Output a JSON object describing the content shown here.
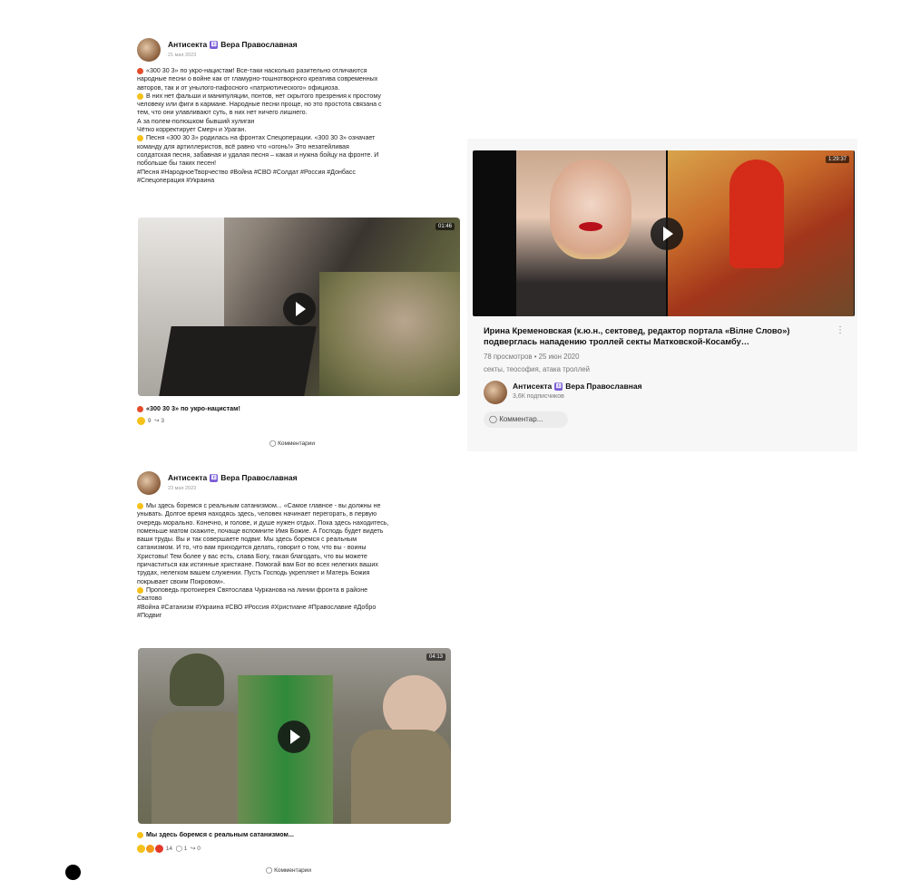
{
  "post1": {
    "author": "Антисекта",
    "author2": "Вера Православная",
    "badge": "⚅",
    "date": "21 мая 2023",
    "text": [
      "«300 30 3» по укро-нацистам! Все-таки насколько разительно отличаются",
      "народные песни о войне как от гламурно-тошнотворного креатива современных",
      "авторов, так и от унылого-пафосного «патриотического» официоза.",
      "В них нет фальши и манипуляции, понтов, нет скрытого презрения к простому",
      "человеку или фиги в кармане. Народные песни проще, но это простота связана с",
      "тем, что они улавливают суть, в них нет ничего лишнего.",
      "А за полем-полюшком бывший хулиган",
      "Чётко корректирует Смерч и Ураган.",
      "Песня «300 30 3» родилась на фронтах Спецоперации. «300 30 3» означает",
      "команду для артиллеристов, всё равно что «огонь!» Это незатейливая",
      "солдатская песня, забавная и удалая песня – какая и нужна бойцу на фронте. И",
      "побольше бы таких песен!",
      "#Песня #НародноеТворчество #Война #СВО #Солдат #Россия #Донбасс",
      "#Спецоперация #Украина"
    ],
    "duration": "01:46",
    "caption": "«300 30 3» по укро-нацистам!",
    "reactions_count": "9",
    "shares_count": "3",
    "comments_label": "Комментарии"
  },
  "video_card": {
    "duration": "1:29:37",
    "title": "Ирина Кременовская (к.ю.н., сектовед, редактор портала «Вілне Слово») подверглась нападению троллей секты Матковской-Косамбу…",
    "meta": "78 просмотров • 25 июн 2020",
    "tags": "секты, теософия, атака троллей",
    "author": "Антисекта",
    "author2": "Вера Православная",
    "badge": "⚅",
    "subscribers": "3,6К подписчиков",
    "comment_placeholder": "Комментар...",
    "more": "⋮"
  },
  "post2": {
    "author": "Антисекта",
    "author2": "Вера Православная",
    "badge": "⚅",
    "date": "23 мая 2023",
    "text": [
      "Мы здесь боремся с реальным сатанизмом... «Самое главное - вы должны не",
      "унывать. Долгое время находясь здесь, человек начинает перегорать, в первую",
      "очередь морально. Конечно, и голове, и душе нужен отдых. Пока здесь находитесь,",
      "поменьше матом скажите, почаще вспомните Имя Божие. А Господь будет видеть",
      "ваши труды. Вы и так совершаете подвиг. Мы здесь боремся с реальным",
      "сатанизмом. И то, что вам приходится делать, говорит о том, что вы - воины",
      "Христовы! Тем более у вас есть, слава Богу, такая благодать, что вы можете",
      "причаститься как истинные христиане. Помогай вам Бог во всех нелегких ваших",
      "трудах, нелегком вашем служении. Пусть Господь укрепляет и Матерь Божия",
      "покрывает своим Покровом».",
      "Проповедь протоиерея Святослава Чурканова на линии фронта в районе",
      "Сватово",
      "#Война #Сатанизм #Украина #СВО #Россия #Христиане #Православие #Добро",
      "#Подвиг"
    ],
    "duration": "04:13",
    "caption": "Мы здесь боремся с реальным сатанизмом...",
    "reactions_count": "14",
    "comments_count": "1",
    "shares_count": "0",
    "comments_label": "Комментарии"
  },
  "colors": {
    "badge": "#7b5cd6",
    "emoji": "#f5c11a",
    "play": "#141414"
  }
}
